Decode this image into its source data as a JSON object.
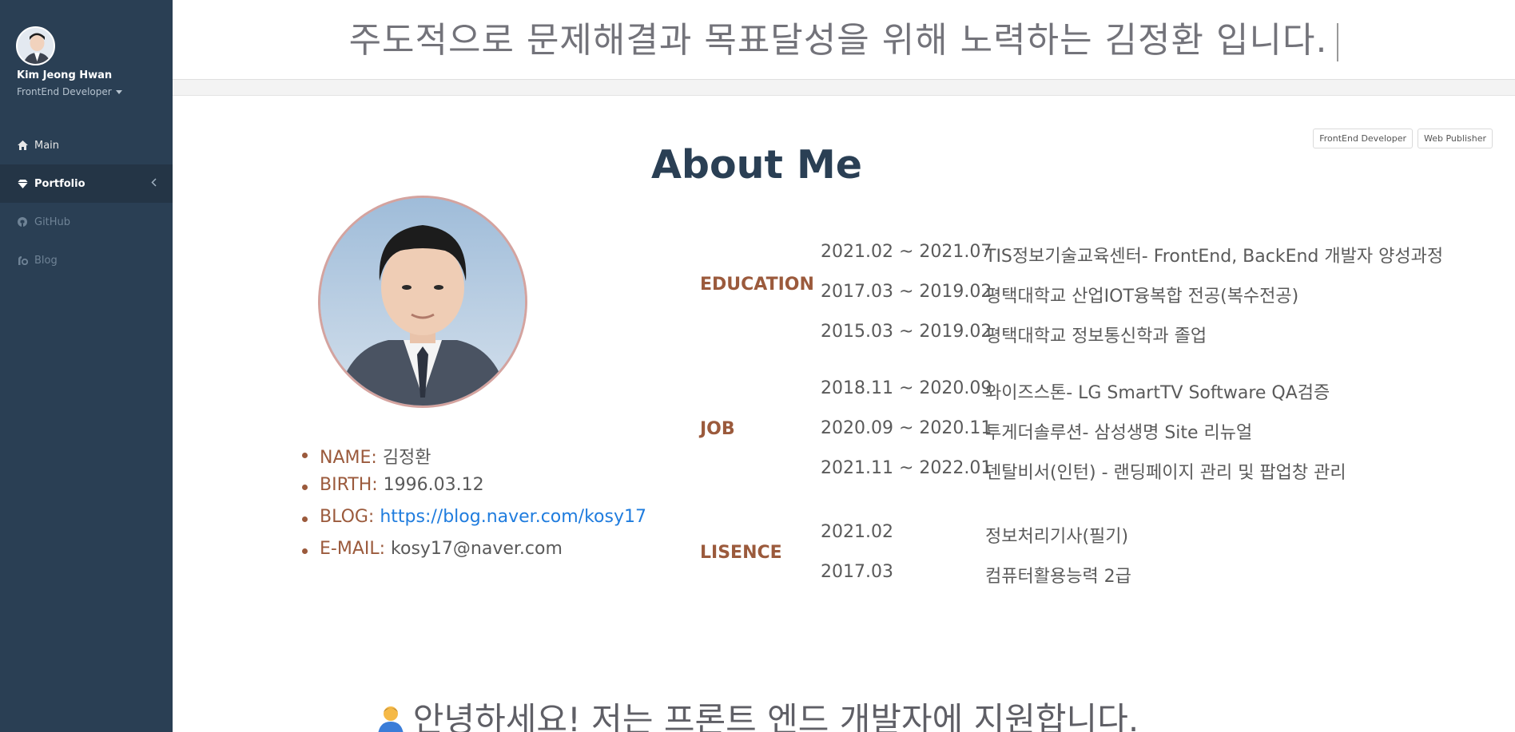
{
  "sidebar": {
    "profile": {
      "name": "Kim Jeong Hwan",
      "role": "FrontEnd Developer"
    },
    "nav": [
      {
        "label": "Main",
        "icon": "home-icon"
      },
      {
        "label": "Portfolio",
        "icon": "diamond-icon",
        "active": true
      },
      {
        "label": "GitHub",
        "icon": "github-icon"
      },
      {
        "label": "Blog",
        "icon": "blog-icon"
      }
    ]
  },
  "header": {
    "typing_title": "주도적으로 문제해결과 목표달성을 위해 노력하는 김정환 입니다."
  },
  "about": {
    "title": "About Me",
    "tags": [
      "FrontEnd Developer",
      "Web Publisher"
    ],
    "info": {
      "name_key": "NAME:",
      "name_value": "김정환",
      "birth_key": "BIRTH:",
      "birth_value": "1996.03.12",
      "blog_key": "BLOG:",
      "blog_value": "https://blog.naver.com/kosy17",
      "email_key": "E-MAIL:",
      "email_value": "kosy17@naver.com"
    },
    "education": {
      "label": "EDUCATION",
      "items": [
        {
          "date": "2021.02 ~ 2021.07",
          "text": "TIS정보기술교육센터- FrontEnd, BackEnd 개발자 양성과정"
        },
        {
          "date": "2017.03 ~ 2019.02",
          "text": "평택대학교 산업IOT융복합 전공(복수전공)"
        },
        {
          "date": "2015.03 ~ 2019.02",
          "text": "평택대학교 정보통신학과 졸업"
        }
      ]
    },
    "job": {
      "label": "JOB",
      "items": [
        {
          "date": "2018.11 ~ 2020.09",
          "text": "와이즈스톤- LG SmartTV Software QA검증"
        },
        {
          "date": "2020.09 ~ 2020.11",
          "text": "투게더솔루션- 삼성생명 Site 리뉴얼"
        },
        {
          "date": "2021.11 ~ 2022.01",
          "text": "덴탈비서(인턴) - 랜딩페이지 관리 및 팝업창 관리"
        }
      ]
    },
    "license": {
      "label": "LISENCE",
      "items": [
        {
          "date": "2021.02",
          "text": "정보처리기사(필기)"
        },
        {
          "date": "2017.03",
          "text": "컴퓨터활용능력 2급"
        }
      ]
    }
  },
  "greeting": {
    "text": "안녕하세요! 저는 프론트 엔드 개발자에 지원합니다."
  },
  "colors": {
    "sidebar_bg": "#2a3f54",
    "accent_brown": "#9b5a3c",
    "title_navy": "#2a3f54",
    "link_blue": "#1f7cde"
  }
}
